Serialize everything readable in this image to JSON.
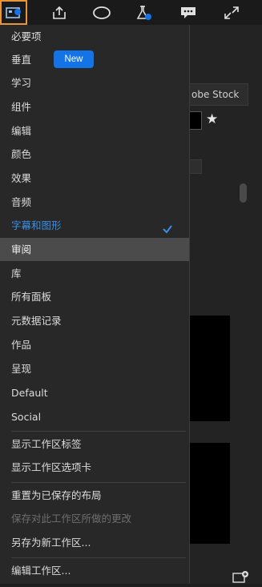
{
  "toolbar": {
    "icons": [
      "workspace-icon",
      "share-icon",
      "ellipse-icon",
      "beaker-icon",
      "comment-icon",
      "expand-icon"
    ]
  },
  "background": {
    "stock_label": "obe Stock",
    "star": "★"
  },
  "menu": {
    "items": [
      {
        "label": "必要项"
      },
      {
        "label": "垂直",
        "badge": "New"
      },
      {
        "label": "学习"
      },
      {
        "label": "组件"
      },
      {
        "label": "编辑"
      },
      {
        "label": "颜色"
      },
      {
        "label": "效果"
      },
      {
        "label": "音频"
      },
      {
        "label": "字幕和图形",
        "selected": true
      },
      {
        "label": "审阅",
        "highlighted": true
      },
      {
        "label": "库"
      },
      {
        "label": "所有面板"
      },
      {
        "label": "元数据记录"
      },
      {
        "label": "作品"
      },
      {
        "label": "呈现"
      },
      {
        "label": "Default"
      },
      {
        "label": "Social"
      },
      {
        "label": "显示工作区标签"
      },
      {
        "label": "显示工作区选项卡"
      },
      {
        "label": "重置为已保存的布局"
      },
      {
        "label": "保存对此工作区所做的更改",
        "disabled": true
      },
      {
        "label": "另存为新工作区..."
      },
      {
        "label": "编辑工作区..."
      }
    ]
  },
  "colors": {
    "accent_selected": "#3a8ee6",
    "badge_bg": "#1473e6",
    "active_outline": "#e8953a"
  }
}
